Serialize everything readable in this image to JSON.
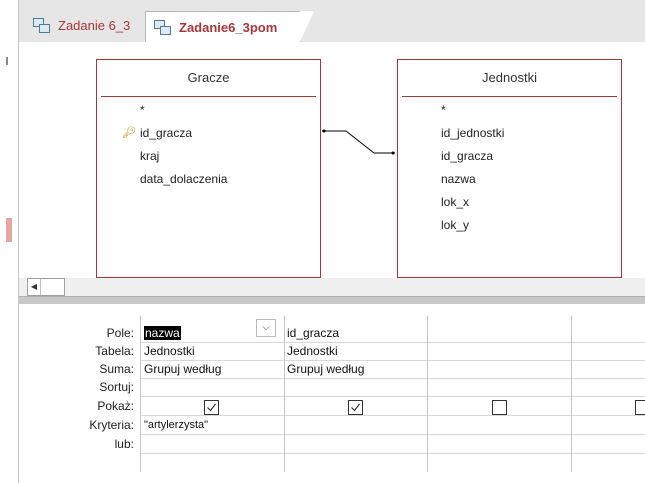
{
  "tabs": [
    {
      "label": "Zadanie 6_3"
    },
    {
      "label": "Zadanie6_3pom"
    }
  ],
  "tables": [
    {
      "name": "Gracze",
      "fields": [
        "*",
        "id_gracza",
        "kraj",
        "data_dolaczenia"
      ],
      "key_field": "id_gracza"
    },
    {
      "name": "Jednostki",
      "fields": [
        "*",
        "id_jednostki",
        "id_gracza",
        "nazwa",
        "lok_x",
        "lok_y"
      ]
    }
  ],
  "grid": {
    "row_labels": [
      "Pole:",
      "Tabela:",
      "Suma:",
      "Sortuj:",
      "Pokaż:",
      "Kryteria:",
      "lub:"
    ],
    "columns": [
      {
        "field": "nazwa",
        "table": "Jednostki",
        "total": "Grupuj według",
        "sort": "",
        "show": true,
        "criteria": "\"artylerzysta\"",
        "or": ""
      },
      {
        "field": "id_gracza",
        "table": "Jednostki",
        "total": "Grupuj według",
        "sort": "",
        "show": true,
        "criteria": "",
        "or": ""
      },
      {
        "field": "",
        "table": "",
        "total": "",
        "sort": "",
        "show": false,
        "criteria": "",
        "or": ""
      },
      {
        "field": "",
        "table": "",
        "total": "",
        "sort": "",
        "show": false,
        "criteria": "",
        "or": ""
      }
    ]
  },
  "icons": {
    "tab_icon": "query-design-icon",
    "key": "primary-key-icon",
    "dropdown": "chevron-down-icon"
  },
  "colors": {
    "accent": "#a4373a"
  }
}
